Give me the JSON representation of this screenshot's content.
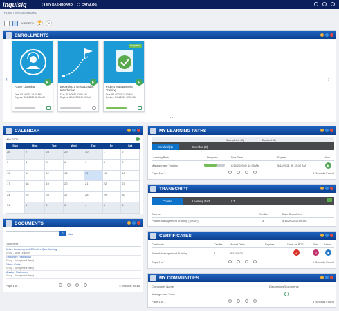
{
  "app": {
    "logo": "inquisiq",
    "nav_dashboard": "MY DASHBOARD",
    "nav_catalog": "CATALOG"
  },
  "breadcrumb": "HOME / MY DASHBOARD",
  "widgets_label": "WIDGETS",
  "enrollments": {
    "title": "ENROLLMENTS",
    "cards": [
      {
        "title": "Active Listening",
        "due": "Due: 8/16/2020 12:00 AM",
        "expires": "Expires: 8/16/2020 12:00 AM",
        "progress": 0
      },
      {
        "title": "Becoming a Great Leader: Introduction",
        "due": "Due: 8/16/2020 12:00 AM",
        "expires": "Expires: 8/16/2020 12:00 AM",
        "progress": 0
      },
      {
        "title": "Project Management Training",
        "due": "Due: 8/14/2020 12:00 AM",
        "expires": "Expires: 8/14/2020 12:00 AM",
        "progress": 1,
        "badge": "Completed"
      }
    ],
    "dots": "• • •"
  },
  "calendar": {
    "title": "CALENDAR",
    "month": "MAY 2020",
    "days": [
      "Sun",
      "Mon",
      "Tue",
      "Wed",
      "Thu",
      "Fri",
      "Sat"
    ],
    "weeks": [
      [
        "26",
        "27",
        "28",
        "29",
        "30",
        "1",
        "2"
      ],
      [
        "3",
        "4",
        "5",
        "6",
        "7",
        "8",
        "9"
      ],
      [
        "10",
        "11",
        "12",
        "13",
        "14",
        "15",
        "16"
      ],
      [
        "17",
        "18",
        "19",
        "20",
        "21",
        "22",
        "23"
      ],
      [
        "24",
        "25",
        "26",
        "27",
        "28",
        "29",
        "30"
      ],
      [
        "31",
        "1",
        "2",
        "3",
        "4",
        "5",
        "6"
      ]
    ]
  },
  "documents": {
    "title": "DOCUMENTS",
    "search_placeholder": "",
    "clear": "clear",
    "header": "Document",
    "items": [
      {
        "name": "Active Learning and Effective Questioning",
        "group": "(Group - Active Learning)"
      },
      {
        "name": "Employee Handbook",
        "group": "(Group - Management Team)"
      },
      {
        "name": "Ethics Code",
        "group": "(Group - Management Team)"
      },
      {
        "name": "Mission Statement",
        "group": "(Group - Management Team)"
      }
    ],
    "page": "Page 1 of 1",
    "records": "4 Records Found"
  },
  "learning_paths": {
    "title": "MY LEARNING PATHS",
    "stat_tabs": [
      "Completed (0)",
      "Expired (0)"
    ],
    "tabs": [
      "Enrolled (1)",
      "Overdue (0)"
    ],
    "headers": [
      "Learning Path",
      "Progress",
      "Due Date",
      "Expires",
      "View"
    ],
    "row": {
      "name": "Management Training",
      "progress": 0.6,
      "due": "8/14/2020 @ 12:00 AM",
      "expires": "5/14/2021 @ 12:00 AM"
    },
    "page": "Page 1 of 1",
    "records": "1 Records Found"
  },
  "transcript": {
    "title": "TRANSCRIPT",
    "tabs": [
      "Course",
      "Learning Path",
      "ILT"
    ],
    "headers": [
      "Course",
      "Credits",
      "Date Completed"
    ],
    "row": {
      "course": "Project Management Training (K0307)",
      "credits": "3",
      "date": "5/14/2020 11:08 AM"
    }
  },
  "certificates": {
    "title": "CERTIFICATES",
    "headers": [
      "Certificate",
      "Credits",
      "Award Date",
      "Expires",
      "Save as PDF",
      "Print",
      "View"
    ],
    "row": {
      "name": "Project Management Training",
      "credits": "3",
      "award": "5/14/2020"
    },
    "page": "Page 1 of 1",
    "records": "1 Records Found"
  },
  "communities": {
    "title": "MY COMMUNITIES",
    "headers": [
      "Community Name",
      "Discussions/Documents"
    ],
    "row": {
      "name": "Management Team"
    },
    "page": "Page 1 of 1",
    "records": "1 Records Found"
  }
}
